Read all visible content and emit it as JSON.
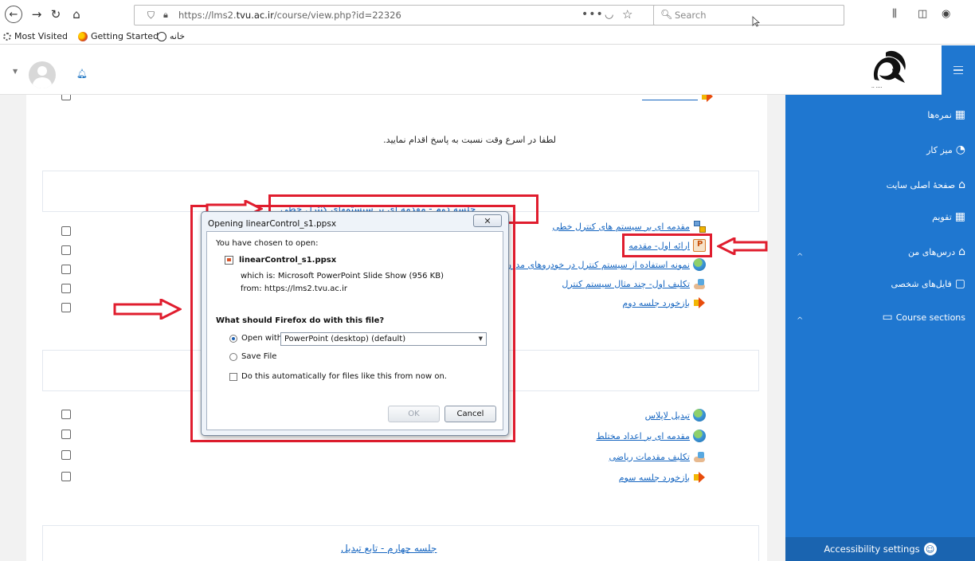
{
  "browser": {
    "url_prefix": "https://lms2.",
    "url_domain": "tvu.ac.ir",
    "url_path": "/course/view.php?id=22326",
    "url_dots": "•••",
    "search_placeholder": "Search",
    "bookmarks": [
      "Most Visited",
      "Getting Started",
      "خانه"
    ]
  },
  "sidebar": {
    "items": [
      {
        "label": "نمره‌ها",
        "icon": "gradebook-icon"
      },
      {
        "label": "میز کار",
        "icon": "dashboard-icon"
      },
      {
        "label": "صفحهٔ اصلی سایت",
        "icon": "home-icon"
      },
      {
        "label": "تقویم",
        "icon": "calendar-icon"
      },
      {
        "label": "درس‌های من",
        "icon": "graduation-cap-icon"
      },
      {
        "label": "فایل‌های شخصی",
        "icon": "file-icon"
      },
      {
        "label": "Course sections",
        "icon": "folder-icon"
      }
    ],
    "footer": "Accessibility settings"
  },
  "course": {
    "top_note": "لطفا در اسرع وقت نسبت به پاسخ اقدام نمایید.",
    "section2_title": "جلسه دوم - مقدمه ای بر سیستمهای کنترل خطی",
    "section2_items": [
      {
        "label": "مقدمه ای بر سیستم های کنترل خطی",
        "icon": "folder-tree-icon"
      },
      {
        "label": "ارائه اول- مقدمه",
        "icon": "powerpoint-icon"
      },
      {
        "label": "نمونه استفاده از سیستم کنترل در خودروهای مدرن",
        "icon": "globe-url-icon"
      },
      {
        "label": "تکلیف اول- چند مثال سیستم کنترل",
        "icon": "assignment-icon"
      },
      {
        "label": "بازخورد جلسه دوم",
        "icon": "feedback-icon"
      }
    ],
    "section3_items": [
      {
        "label": "تبدیل لاپلاس",
        "icon": "globe-url-icon"
      },
      {
        "label": "مقدمه ای بر اعداد مختلط",
        "icon": "globe-url-icon"
      },
      {
        "label": "تکلیف مقدمات ریاضی",
        "icon": "assignment-icon"
      },
      {
        "label": "بازخورد جلسه سوم",
        "icon": "feedback-icon"
      }
    ],
    "section4_title": "جلسه چهارم - تابع تبدیل"
  },
  "dialog": {
    "title": "Opening linearControl_s1.ppsx",
    "chosen": "You have chosen to open:",
    "filename": "linearControl_s1.ppsx",
    "which_is": "which is:  Microsoft PowerPoint Slide Show (956 KB)",
    "from": "from:  https://lms2.tvu.ac.ir",
    "question": "What should Firefox do with this file?",
    "open_with_label": "Open with",
    "open_with_value": "PowerPoint (desktop) (default)",
    "save_file_label": "Save File",
    "auto_label": "Do this automatically for files like this from now on.",
    "ok": "OK",
    "cancel": "Cancel"
  },
  "colors": {
    "sidebar_bg": "#1f77d0",
    "annotation_red": "#e01d2e",
    "link": "#1565c0"
  }
}
